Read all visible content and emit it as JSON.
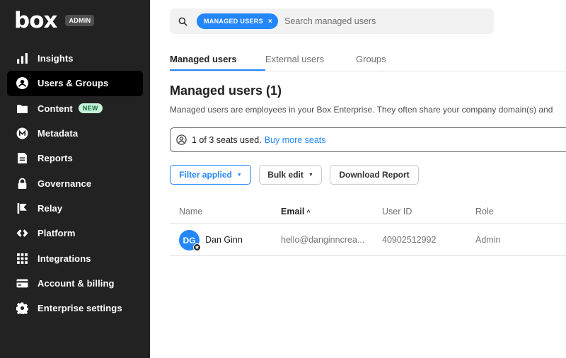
{
  "sidebar": {
    "logo": "box",
    "admin_badge": "ADMIN",
    "items": [
      {
        "label": "Insights",
        "icon": "bar-chart-icon"
      },
      {
        "label": "Users & Groups",
        "icon": "user-circle-icon",
        "active": true
      },
      {
        "label": "Content",
        "icon": "folder-icon",
        "badge": "NEW"
      },
      {
        "label": "Metadata",
        "icon": "metadata-icon"
      },
      {
        "label": "Reports",
        "icon": "reports-icon"
      },
      {
        "label": "Governance",
        "icon": "lock-icon"
      },
      {
        "label": "Relay",
        "icon": "relay-icon"
      },
      {
        "label": "Platform",
        "icon": "platform-icon"
      },
      {
        "label": "Integrations",
        "icon": "grid-icon"
      },
      {
        "label": "Account & billing",
        "icon": "credit-card-icon"
      },
      {
        "label": "Enterprise settings",
        "icon": "gear-icon"
      }
    ]
  },
  "search": {
    "chip": "MANAGED USERS",
    "chip_close": "×",
    "placeholder": "Search managed users"
  },
  "tabs": [
    "Managed users",
    "External users",
    "Groups"
  ],
  "page": {
    "title": "Managed users (1)",
    "description": "Managed users are employees in your Box Enterprise. They often share your company domain(s) and"
  },
  "seats": {
    "text": "1 of 3 seats used.",
    "link": "Buy more seats"
  },
  "buttons": {
    "filter": "Filter applied",
    "bulk": "Bulk edit",
    "download": "Download Report",
    "caret": "▼"
  },
  "table": {
    "columns": [
      "Name",
      "Email",
      "User ID",
      "Role"
    ],
    "sort_arrow": "^",
    "rows": [
      {
        "initials": "DG",
        "name": "Dan Ginn",
        "email": "hello@danginncrea...",
        "user_id": "40902512992",
        "role": "Admin"
      }
    ]
  },
  "colors": {
    "accent": "#2486fc",
    "sidebar_bg": "#222222",
    "new_badge_bg": "#c5f3d9"
  }
}
